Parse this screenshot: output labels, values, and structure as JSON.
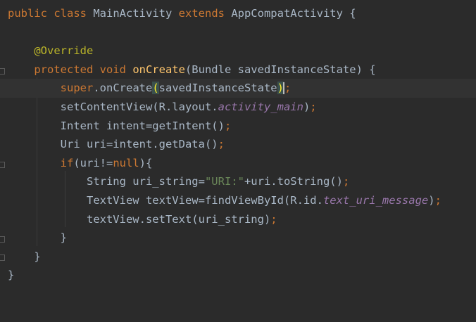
{
  "editor": {
    "language": "java",
    "theme": "darcula",
    "colors": {
      "background": "#2b2b2b",
      "keyword": "#cc7832",
      "annotation": "#bbb529",
      "method_declaration": "#ffc66d",
      "string": "#6a8759",
      "static_field": "#9876aa",
      "default_text": "#a9b7c6"
    },
    "lines": [
      {
        "t1": "public class ",
        "t2": "MainActivity ",
        "t3": "extends ",
        "t4": "AppCompatActivity {"
      },
      {},
      {
        "t1": "    ",
        "t2": "@Override"
      },
      {
        "t1": "    ",
        "t2": "protected void ",
        "t3": "onCreate",
        "t4": "(Bundle savedInstanceState) {"
      },
      {
        "t1": "        ",
        "t2": "super",
        "t3": ".onCreate",
        "t4": "(",
        "t5": "savedInstanceState",
        "t6": ")",
        "t7": ";"
      },
      {
        "t1": "        setContentView(R.layout.",
        "t2": "activity_main",
        "t3": ")",
        "t4": ";"
      },
      {
        "t1": "        Intent intent=getIntent()",
        "t2": ";"
      },
      {
        "t1": "        Uri uri=intent.getData()",
        "t2": ";"
      },
      {
        "t1": "        ",
        "t2": "if",
        "t3": "(uri!=",
        "t4": "null",
        "t5": "){"
      },
      {
        "t1": "            String uri_string=",
        "t2": "\"URI:\"",
        "t3": "+uri.toString()",
        "t4": ";"
      },
      {
        "t1": "            TextView textView=findViewById(R.id.",
        "t2": "text_uri_message",
        "t3": ")",
        "t4": ";"
      },
      {
        "t1": "            textView.setText(uri_string)",
        "t2": ";"
      },
      {
        "t1": "        }"
      },
      {
        "t1": "    }"
      },
      {
        "t1": "}"
      }
    ]
  }
}
